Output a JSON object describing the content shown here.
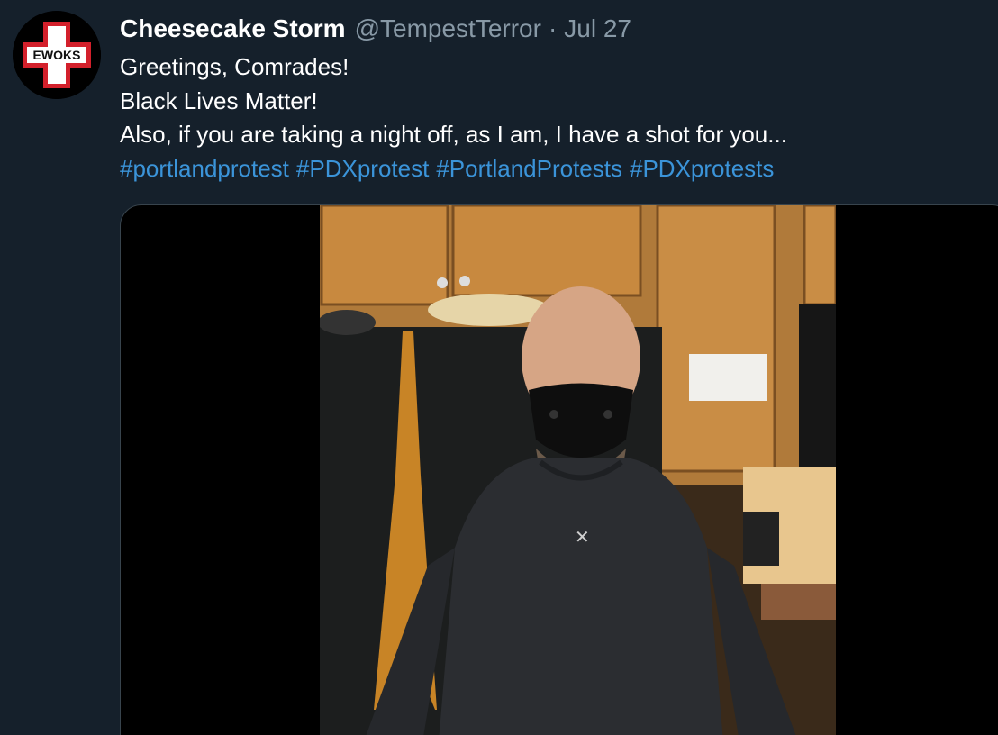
{
  "tweet": {
    "display_name": "Cheesecake Storm",
    "handle": "@TempestTerror",
    "separator": "·",
    "date": "Jul 27",
    "text_lines": [
      "Greetings, Comrades!",
      "Black Lives Matter!",
      "Also, if you are taking a night off, as I am, I have a shot for you..."
    ],
    "hashtags": [
      "#portlandprotest",
      "#PDXprotest",
      "#PortlandProtests",
      "#PDXprotests"
    ],
    "avatar_text": "EWOKS"
  },
  "colors": {
    "background": "#15202b",
    "text": "#ffffff",
    "muted": "#8899a6",
    "link": "#3b94d9",
    "avatar_red": "#d3202b"
  },
  "media": {
    "type": "video",
    "subject_icon": "masked-man-in-kitchen-video-frame"
  }
}
